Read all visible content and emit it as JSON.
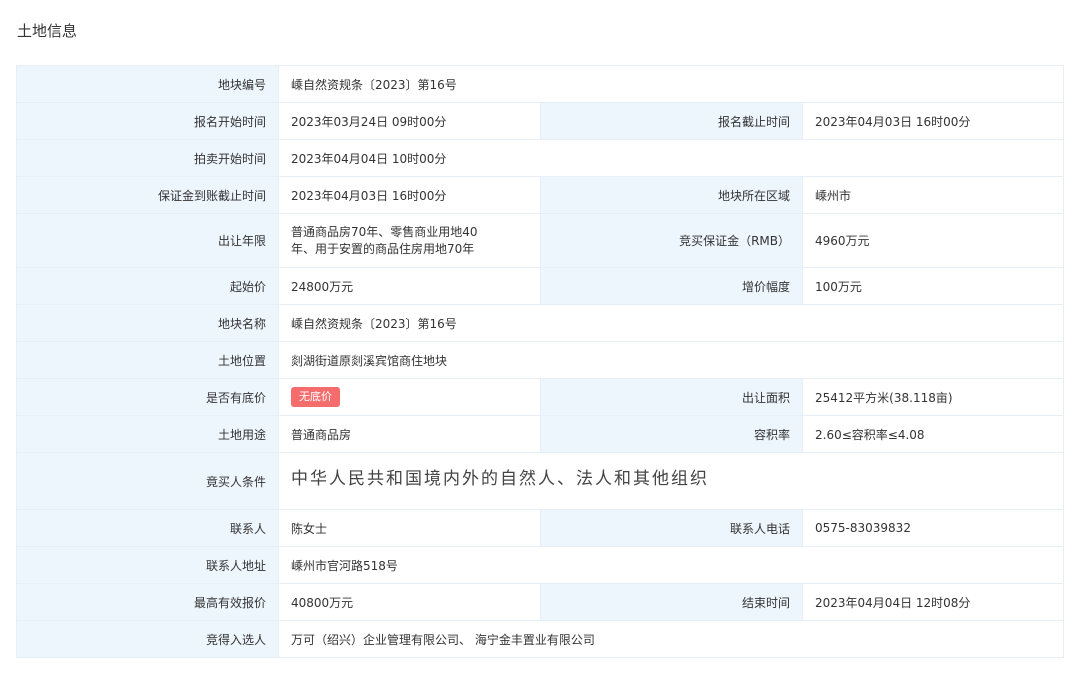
{
  "page": {
    "title": "土地信息"
  },
  "rows": {
    "plot_number": {
      "label": "地块编号",
      "value": "嵊自然资规条〔2023〕第16号"
    },
    "reg_start": {
      "label": "报名开始时间",
      "value": "2023年03月24日 09时00分"
    },
    "reg_end": {
      "label": "报名截止时间",
      "value": "2023年04月03日 16时00分"
    },
    "auction_start": {
      "label": "拍卖开始时间",
      "value": "2023年04月04日 10时00分"
    },
    "deposit_deadline": {
      "label": "保证金到账截止时间",
      "value": "2023年04月03日 16时00分"
    },
    "district": {
      "label": "地块所在区域",
      "value": "嵊州市"
    },
    "term": {
      "label": "出让年限",
      "value_line1": "普通商品房70年、零售商业用地40",
      "value_line2": "年、用于安置的商品住房用地70年"
    },
    "deposit": {
      "label": "竞买保证金（RMB）",
      "value": "4960万元"
    },
    "start_price": {
      "label": "起始价",
      "value": "24800万元"
    },
    "increment": {
      "label": "增价幅度",
      "value": "100万元"
    },
    "plot_name": {
      "label": "地块名称",
      "value": "嵊自然资规条〔2023〕第16号"
    },
    "location": {
      "label": "土地位置",
      "value": "剡湖街道原剡溪宾馆商住地块"
    },
    "reserve_price": {
      "label": "是否有底价",
      "badge": "无底价"
    },
    "area": {
      "label": "出让面积",
      "value": "25412平方米(38.118亩)"
    },
    "land_use": {
      "label": "土地用途",
      "value": "普通商品房"
    },
    "plot_ratio": {
      "label": "容积率",
      "value": "2.60≤容积率≤4.08"
    },
    "bidder_conditions": {
      "label": "竟买人条件",
      "value": "中华人民共和国境内外的自然人、法人和其他组织"
    },
    "contact": {
      "label": "联系人",
      "value": "陈女士"
    },
    "contact_phone": {
      "label": "联系人电话",
      "value": "0575-83039832"
    },
    "contact_address": {
      "label": "联系人地址",
      "value": "嵊州市官河路518号"
    },
    "highest_bid": {
      "label": "最高有效报价",
      "value": "40800万元"
    },
    "end_time": {
      "label": "结束时间",
      "value": "2023年04月04日 12时08分"
    },
    "winner": {
      "label": "竞得入选人",
      "value": "万可（绍兴）企业管理有限公司、 海宁金丰置业有限公司"
    }
  }
}
